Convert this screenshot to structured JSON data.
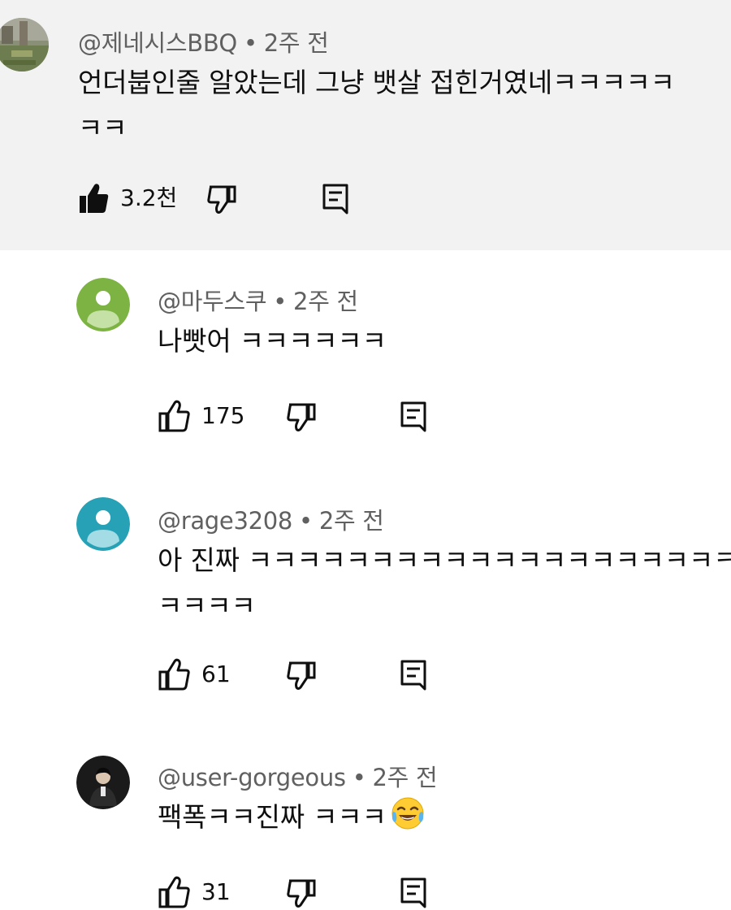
{
  "comments": [
    {
      "author": "@제네시스BBQ",
      "separator": "•",
      "time": "2주 전",
      "text_line1": "언더붑인줄 알았는데 그냥 뱃살 접힌거였네ㅋㅋㅋㅋㅋ",
      "text_line2": "ㅋㅋ",
      "likes": "3.2천",
      "liked": true
    },
    {
      "author": "@마두스쿠",
      "separator": "•",
      "time": "2주 전",
      "text_line1": "나빳어 ㅋㅋㅋㅋㅋㅋ",
      "likes": "175",
      "liked": false,
      "avatar_color": "#7cb342"
    },
    {
      "author": "@rage3208",
      "separator": "•",
      "time": "2주 전",
      "text_line1": "아 진짜 ㅋㅋㅋㅋㅋㅋㅋㅋㅋㅋㅋㅋㅋㅋㅋㅋㅋㅋㅋㅋㅋ",
      "text_line2": "ㅋㅋㅋㅋ",
      "likes": "61",
      "liked": false,
      "avatar_color": "#26a1b5"
    },
    {
      "author": "@user-gorgeous",
      "separator": "•",
      "time": "2주 전",
      "text_line1": "팩폭ㅋㅋ진짜 ㅋㅋㅋ",
      "emoji": "face-with-tears-of-joy",
      "likes": "31",
      "liked": false
    }
  ],
  "colors": {
    "highlight_bg": "#f2f2f2",
    "meta_text": "#606060",
    "body_text": "#0f0f0f"
  },
  "icons": [
    "thumb-up-icon",
    "thumb-down-icon",
    "reply-icon",
    "default-avatar-icon",
    "face-with-tears-of-joy-emoji"
  ]
}
